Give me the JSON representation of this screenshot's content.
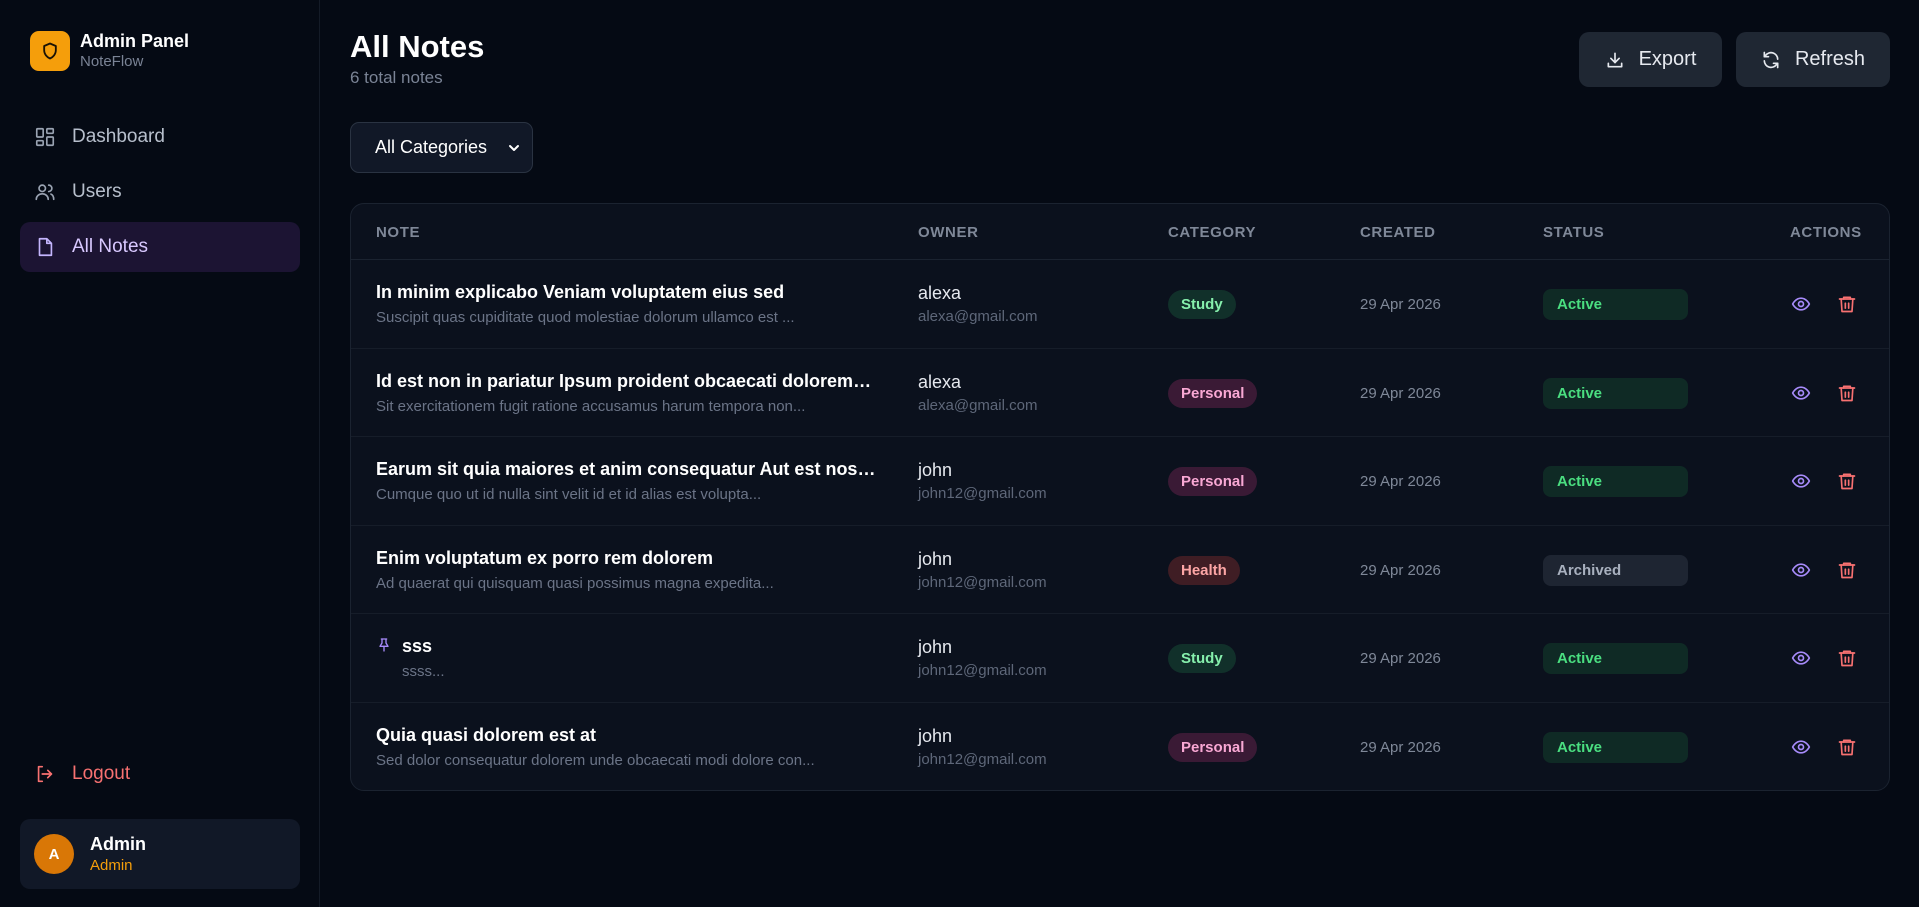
{
  "brand": {
    "title": "Admin Panel",
    "subtitle": "NoteFlow"
  },
  "nav": {
    "items": [
      {
        "label": "Dashboard",
        "icon": "dashboard-icon"
      },
      {
        "label": "Users",
        "icon": "users-icon"
      },
      {
        "label": "All Notes",
        "icon": "file-icon"
      }
    ],
    "logout": "Logout"
  },
  "user": {
    "initial": "A",
    "name": "Admin",
    "role": "Admin"
  },
  "header": {
    "title": "All Notes",
    "subtitle": "6 total notes",
    "export_label": "Export",
    "refresh_label": "Refresh"
  },
  "filter": {
    "selected": "All Categories"
  },
  "table": {
    "columns": [
      "NOTE",
      "OWNER",
      "CATEGORY",
      "CREATED",
      "STATUS",
      "ACTIONS"
    ],
    "rows": [
      {
        "title": "In minim explicabo Veniam voluptatem eius sed",
        "body": "Suscipit quas cupiditate quod molestiae dolorum ullamco est ...",
        "owner": "alexa",
        "email": "alexa@gmail.com",
        "category": "Study",
        "created": "29 Apr 2026",
        "status": "Active"
      },
      {
        "title": "Id est non in pariatur Ipsum proident obcaecati dolorem e...",
        "body": "Sit exercitationem fugit ratione accusamus harum tempora non...",
        "owner": "alexa",
        "email": "alexa@gmail.com",
        "category": "Personal",
        "created": "29 Apr 2026",
        "status": "Active"
      },
      {
        "title": "Earum sit quia maiores et anim consequatur Aut est nostru...",
        "body": "Cumque quo ut id nulla sint velit id et id alias est volupta...",
        "owner": "john",
        "email": "john12@gmail.com",
        "category": "Personal",
        "created": "29 Apr 2026",
        "status": "Active"
      },
      {
        "title": "Enim voluptatum ex porro rem dolorem",
        "body": "Ad quaerat qui quisquam quasi possimus magna expedita...",
        "owner": "john",
        "email": "john12@gmail.com",
        "category": "Health",
        "created": "29 Apr 2026",
        "status": "Archived"
      },
      {
        "title": "sss",
        "body": "ssss...",
        "owner": "john",
        "email": "john12@gmail.com",
        "category": "Study",
        "created": "29 Apr 2026",
        "status": "Active",
        "pinned": true
      },
      {
        "title": "Quia quasi dolorem est at",
        "body": "Sed dolor consequatur dolorem unde obcaecati modi dolore con...",
        "owner": "john",
        "email": "john12@gmail.com",
        "category": "Personal",
        "created": "29 Apr 2026",
        "status": "Active"
      }
    ]
  },
  "colors": {
    "accent": "#a78bfa",
    "brand": "#f59e0b",
    "danger": "#f87171",
    "active": "#4ade80"
  }
}
